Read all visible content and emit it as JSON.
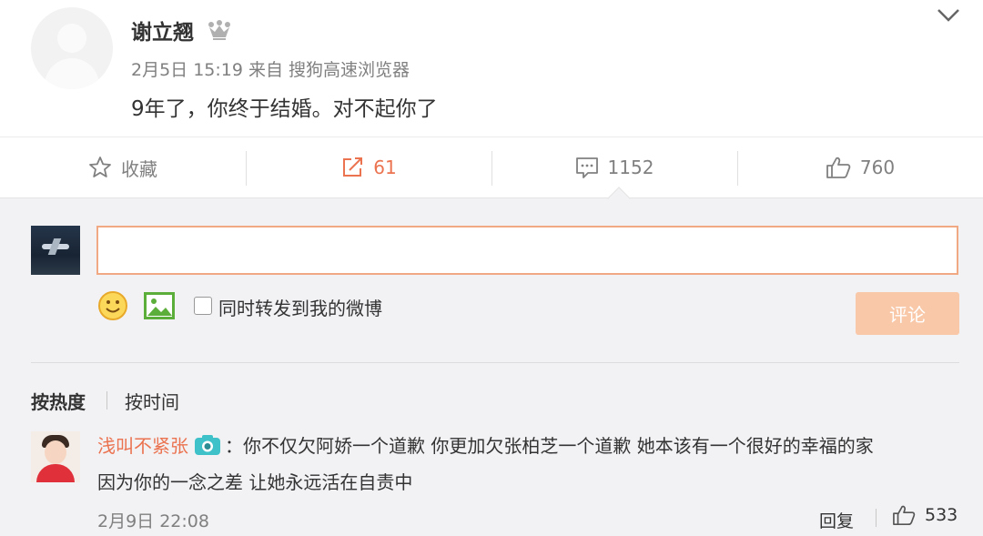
{
  "post": {
    "author": "谢立翘",
    "date": "2月5日 15:19",
    "via_label": "来自",
    "source": "搜狗高速浏览器",
    "text": "9年了，你终于结婚。对不起你了"
  },
  "actions": {
    "favorite_label": "收藏",
    "repost_count": "61",
    "comment_count": "1152",
    "like_count": "760"
  },
  "composer": {
    "input_value": "",
    "repost_label": "同时转发到我的微博",
    "submit_label": "评论"
  },
  "sort": {
    "by_heat": "按热度",
    "by_time": "按时间"
  },
  "comment": {
    "user": "浅叫不紧张",
    "colon": "：",
    "text_line1": "你不仅欠阿娇一个道歉 你更加欠张柏芝一个道歉 她本该有一个很好的幸福的家",
    "text_line2": "因为你的一念之差 让她永远活在自责中",
    "time": "2月9日 22:08",
    "reply_label": "回复",
    "like_count": "533"
  },
  "colors": {
    "accent": "#eb7350",
    "button_disabled": "#f9c8a8",
    "panel_bg": "#f2f2f5"
  }
}
